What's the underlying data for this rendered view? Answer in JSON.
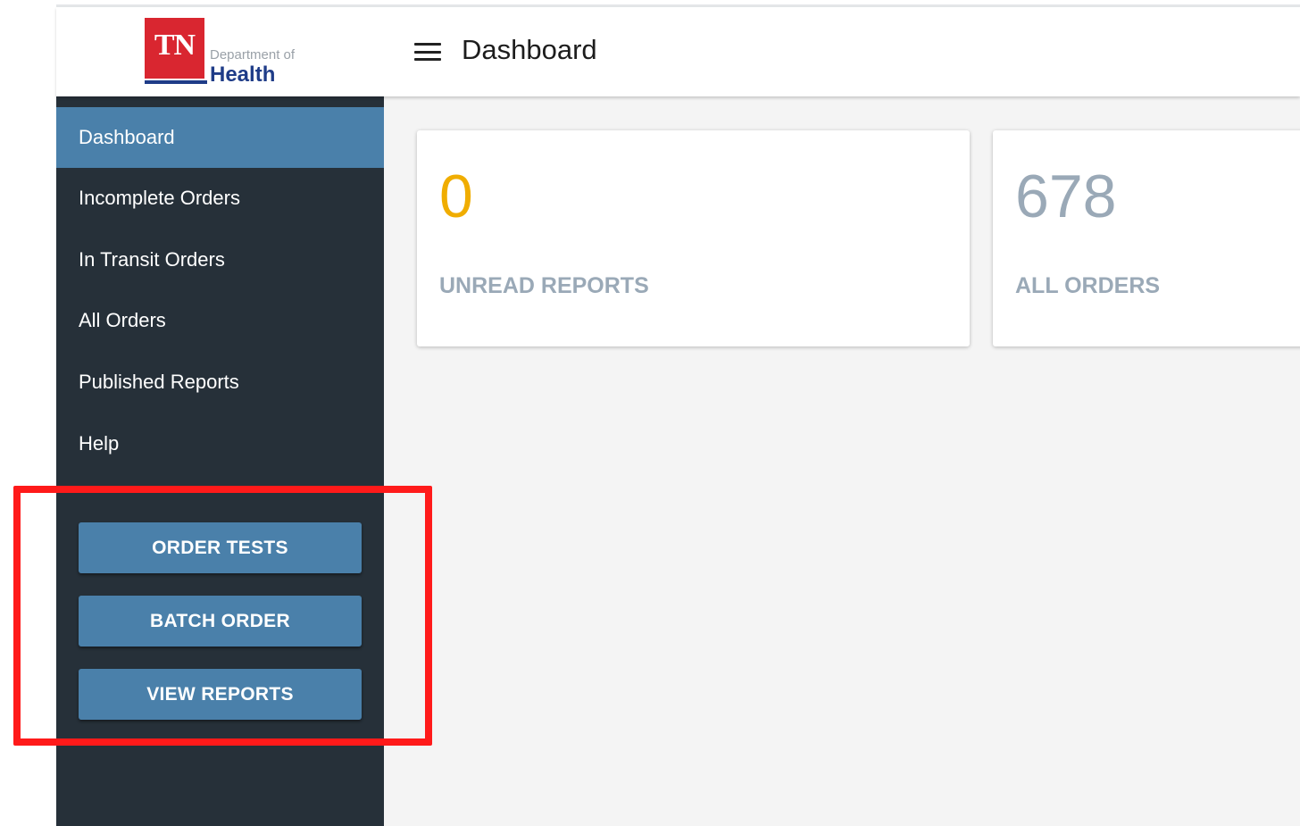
{
  "logo": {
    "abbr": "TN",
    "dept": "Department of",
    "name": "Health"
  },
  "header": {
    "title": "Dashboard",
    "menu_icon": "hamburger-menu-icon"
  },
  "sidebar": {
    "items": [
      {
        "label": "Dashboard",
        "active": true
      },
      {
        "label": "Incomplete Orders",
        "active": false
      },
      {
        "label": "In Transit Orders",
        "active": false
      },
      {
        "label": "All Orders",
        "active": false
      },
      {
        "label": "Published Reports",
        "active": false
      },
      {
        "label": "Help",
        "active": false
      }
    ],
    "buttons": [
      {
        "label": "ORDER TESTS"
      },
      {
        "label": "BATCH ORDER"
      },
      {
        "label": "VIEW REPORTS"
      }
    ]
  },
  "cards": [
    {
      "value": "0",
      "label": "UNREAD REPORTS",
      "color": "#f0ad00"
    },
    {
      "value": "678",
      "label": "ALL ORDERS",
      "color": "#9aa9b7"
    }
  ],
  "colors": {
    "accent": "#4a80aa",
    "sidebar_bg": "#263039",
    "highlight": "#ff1a1a",
    "brand_red": "#d92630",
    "brand_blue": "#1f3c88"
  }
}
